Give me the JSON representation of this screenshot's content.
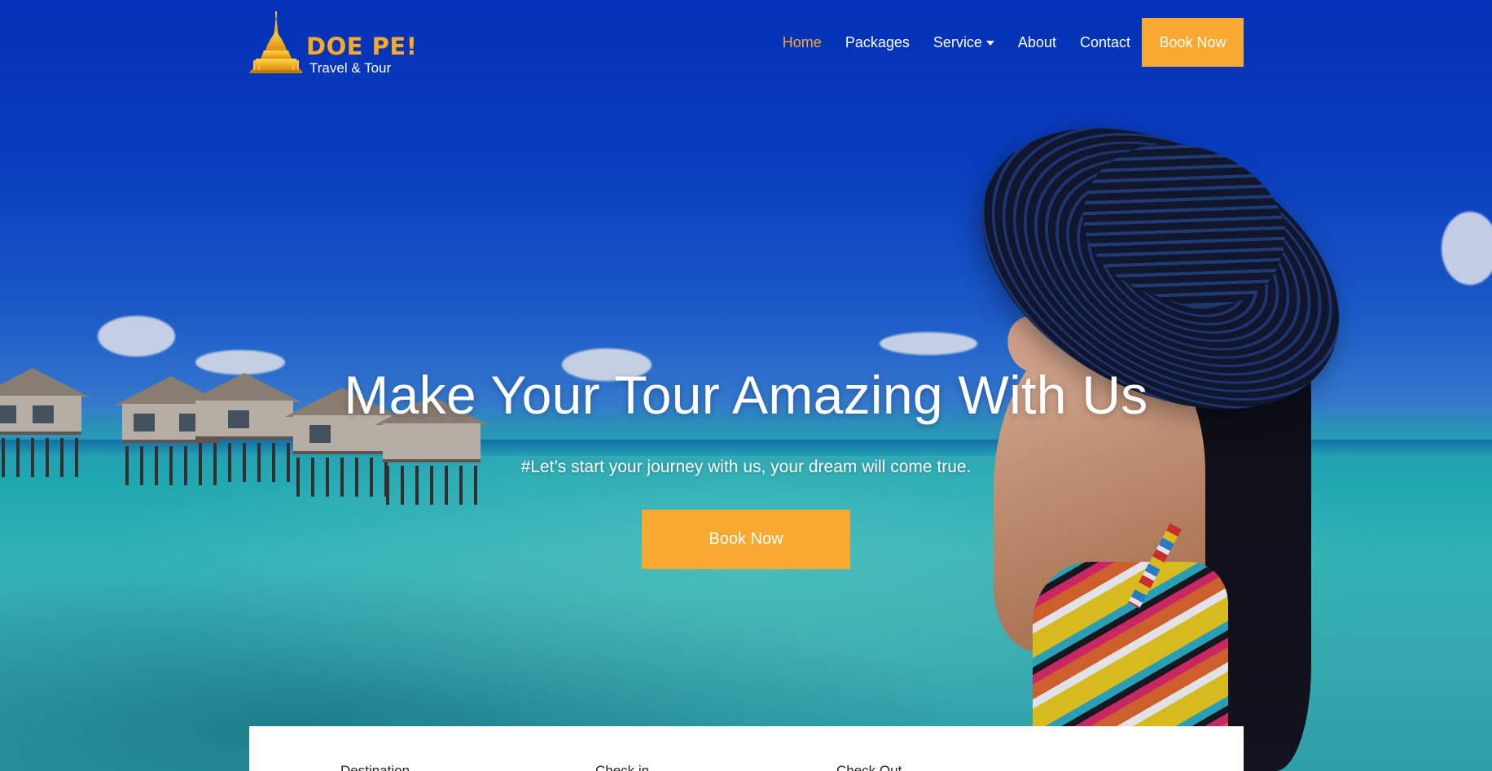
{
  "brand": {
    "name": "DOE PE!",
    "tagline": "Travel & Tour",
    "accent": "#f7a928"
  },
  "nav": {
    "items": [
      {
        "label": "Home",
        "active": true
      },
      {
        "label": "Packages",
        "active": false
      },
      {
        "label": "Service",
        "active": false,
        "dropdown": true
      },
      {
        "label": "About",
        "active": false
      },
      {
        "label": "Contact",
        "active": false
      }
    ],
    "book_label": "Book Now"
  },
  "hero": {
    "title": "Make Your Tour Amazing With Us",
    "subtitle": "#Let’s start your journey with us, your dream will come true.",
    "button_label": "Book Now",
    "button_color": "#f7a931"
  },
  "booking_form": {
    "destination_label": "Destination",
    "checkin_label": "Check in",
    "checkout_label": "Check Out"
  }
}
